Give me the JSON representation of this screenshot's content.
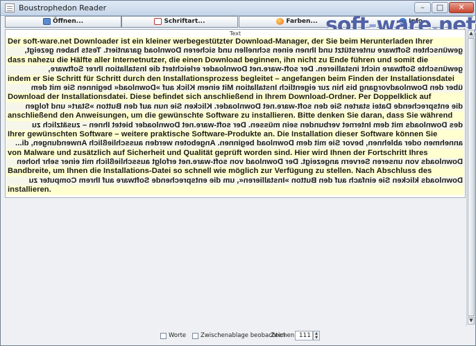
{
  "window": {
    "title": "Boustrophedon Reader"
  },
  "toolbar": {
    "open_label": "Öffnen...",
    "font_label": "Schriftart...",
    "color_label": "Farben...",
    "about_label": "Info..."
  },
  "watermark": {
    "text_a": "soft",
    "text_dash": "-",
    "text_b": "ware",
    "text_dot": ".",
    "text_c": "net"
  },
  "panel": {
    "title": "Text"
  },
  "text_lines": [
    {
      "text": "Der soft-ware.net Downloader ist ein kleiner werbegestützter Download-Manager, der Sie beim Herunterladen Ihrer",
      "reversed": false
    },
    {
      "text": "gewünschten Software unterstützt und Ihnen einen schnellen und sicheren Download garantiert. Tests haben gezeigt,",
      "reversed": true
    },
    {
      "text": "dass nahezu die Hälfte aller Internetnutzer, die einen Download beginnen, ihn nicht zu Ende führen und somit die",
      "reversed": false
    },
    {
      "text": "gewünschte Software nicht installieren. Der soft-ware.net Downloader erleichtert die Installation Ihrer Software,",
      "reversed": true
    },
    {
      "text": "indem er Sie Schritt für Schritt durch den Installationsprozess begleitet – angefangen beim Finden der Installationsdatei",
      "reversed": false
    },
    {
      "text": "über den Downloadvorgang bis hin zur eigentlich Installation Mit einem Klick auf »Download« beginnen Sie mit dem",
      "reversed": true
    },
    {
      "text": "Download der Installationsdatei. Diese befindet sich anschließend in Ihrem Download-Ordner. Per Doppelklick auf",
      "reversed": false
    },
    {
      "text": "die entsprechende Datei starten Sie den soft-ware.net Downloader. Klicken Sie nun auf den Button »Start« und folgen",
      "reversed": true
    },
    {
      "text": "anschließend den Anweisungen, um die gewünschte Software zu installieren. Bitte denken Sie daran, dass Sie während",
      "reversed": false
    },
    {
      "text": "des Downloads mit dem Internet verbunden sein müssen. Der soft-ware.net Downloader bietet Ihnen – zusätzlich zu",
      "reversed": true
    },
    {
      "text": "Ihrer gewünschten Software – weitere praktische Software-Produkte an. Die Installation dieser Software können Sie",
      "reversed": false
    },
    {
      "text": "annehmen oder ablehnen, bevor Sie mit dem Download beginnen. Angeboten werden ausschließlich Anwendungen, di...",
      "reversed": true
    },
    {
      "text": "von Malware und zusätzlich auf Sicherheit und Qualität geprüft worden sind. Hier wird Ihnen der Fortschritt Ihres",
      "reversed": false
    },
    {
      "text": "Downloads von unseren Servern angezeigt. Der Download von soft-ware.net erfolgt ausschließlich mit einer sehr hohen",
      "reversed": true
    },
    {
      "text": "Bandbreite, um Ihnen die Installations-Datei so schnell wie möglich zur Verfügung zu stellen. Nach Abschluss des",
      "reversed": false
    },
    {
      "text": "Downloads klicken Sie einfach auf den Button »Installieren«, um die entsprechende Software auf Ihrem Computer zu",
      "reversed": true
    },
    {
      "text": "installieren.",
      "reversed": false
    }
  ],
  "statusbar": {
    "words_label": "Worte",
    "clipboard_label": "Zwischenablage beobachten",
    "chars_label": "Zeichen:",
    "chars_value": "111"
  }
}
